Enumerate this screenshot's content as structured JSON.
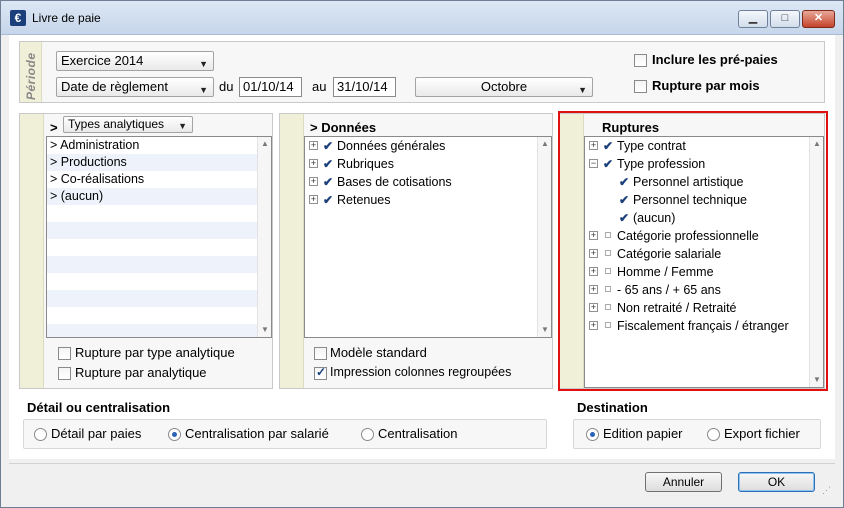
{
  "window": {
    "title": "Livre de paie",
    "app_icon": "€"
  },
  "periode": {
    "label": "Période",
    "exercice": "Exercice 2014",
    "date_type": "Date de règlement",
    "du_label": "du",
    "du_value": "01/10/14",
    "au_label": "au",
    "au_value": "31/10/14",
    "mois": "Octobre",
    "inclure_prepaies": "Inclure les pré-paies",
    "rupture_mois": "Rupture par mois"
  },
  "analytique": {
    "header_prefix": ">",
    "selector": "Types analytiques",
    "items": [
      "> Administration",
      "> Productions",
      "> Co-réalisations",
      "> (aucun)"
    ],
    "rupture_type": "Rupture par type analytique",
    "rupture_analytique": "Rupture par analytique"
  },
  "donnees": {
    "header": "> Données",
    "items": [
      "Données générales",
      "Rubriques",
      "Bases de cotisations",
      "Retenues"
    ],
    "modele_standard": "Modèle standard",
    "impression_colonnes": "Impression colonnes regroupées"
  },
  "ruptures": {
    "header": "Ruptures",
    "items": [
      {
        "label": "Type contrat",
        "expand": "+",
        "checked": true,
        "level": 0
      },
      {
        "label": "Type profession",
        "expand": "−",
        "checked": true,
        "level": 0
      },
      {
        "label": "Personnel artistique",
        "expand": "",
        "checked": true,
        "level": 1
      },
      {
        "label": "Personnel technique",
        "expand": "",
        "checked": true,
        "level": 1
      },
      {
        "label": "(aucun)",
        "expand": "",
        "checked": true,
        "level": 1
      },
      {
        "label": "Catégorie professionnelle",
        "expand": "+",
        "checked": false,
        "level": 0
      },
      {
        "label": "Catégorie salariale",
        "expand": "+",
        "checked": false,
        "level": 0
      },
      {
        "label": "Homme / Femme",
        "expand": "+",
        "checked": false,
        "level": 0
      },
      {
        "label": "- 65 ans / + 65 ans",
        "expand": "+",
        "checked": false,
        "level": 0
      },
      {
        "label": "Non retraité / Retraité",
        "expand": "+",
        "checked": false,
        "level": 0
      },
      {
        "label": "Fiscalement français / étranger",
        "expand": "+",
        "checked": false,
        "level": 0
      }
    ]
  },
  "detail": {
    "title": "Détail ou centralisation",
    "options": [
      "Détail par paies",
      "Centralisation par salarié",
      "Centralisation"
    ],
    "selected": 1
  },
  "destination": {
    "title": "Destination",
    "options": [
      "Edition papier",
      "Export fichier"
    ],
    "selected": 0
  },
  "footer": {
    "annuler": "Annuler",
    "ok": "OK"
  },
  "colors": {
    "highlight": "#e01010",
    "band": "#f0efd8",
    "titlebar": "#dce7f4"
  }
}
